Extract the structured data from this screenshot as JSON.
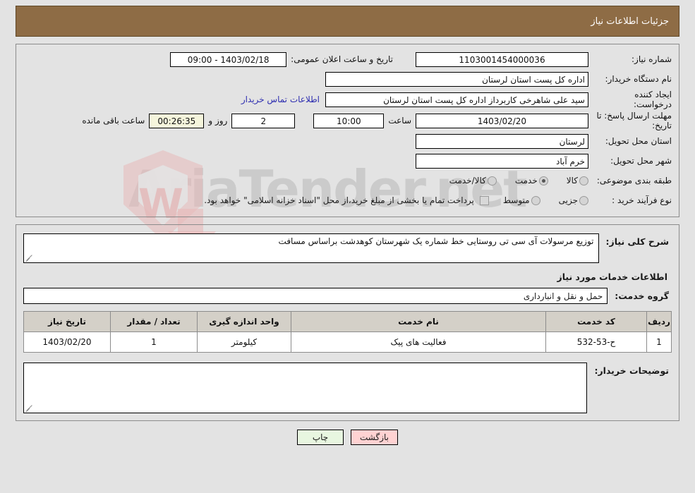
{
  "header": {
    "title": "جزئیات اطلاعات نیاز"
  },
  "form": {
    "need_number_label": "شماره نیاز:",
    "need_number_value": "1103001454000036",
    "announce_label": "تاریخ و ساعت اعلان عمومی:",
    "announce_value": "1403/02/18 - 09:00",
    "buyer_org_label": "نام دستگاه خریدار:",
    "buyer_org_value": "اداره کل پست استان لرستان",
    "creator_label": "ایجاد کننده درخواست:",
    "creator_value": "سید علی شاهرخی کاربرداز اداره کل پست استان لرستان",
    "contact_link": "اطلاعات تماس خریدار",
    "deadline_label": "مهلت ارسال پاسخ: تا تاریخ:",
    "deadline_date": "1403/02/20",
    "hour_label": "ساعت",
    "hour_value": "10:00",
    "days_value": "2",
    "days_label": "روز و",
    "countdown_value": "00:26:35",
    "remaining_label": "ساعت باقی مانده",
    "province_label": "استان محل تحویل:",
    "province_value": "لرستان",
    "city_label": "شهر محل تحویل:",
    "city_value": "خرم آباد",
    "category_label": "طبقه بندی موضوعی:",
    "category_options": [
      {
        "label": "کالا",
        "checked": false
      },
      {
        "label": "خدمت",
        "checked": true
      },
      {
        "label": "کالا/خدمت",
        "checked": false
      }
    ],
    "process_label": "نوع فرآیند خرید :",
    "process_options": [
      {
        "label": "جزیی",
        "checked": false
      },
      {
        "label": "متوسط",
        "checked": false
      }
    ],
    "treasury_checked": false,
    "treasury_note": "پرداخت تمام یا بخشی از مبلغ خرید،از محل \"اسناد خزانه اسلامی\" خواهد بود."
  },
  "need_description": {
    "label": "شرح کلی نیاز:",
    "value": "توزیع مرسولات آی سی تی روستایی خط شماره یک شهرستان کوهدشت براساس مسافت"
  },
  "services_section": {
    "heading": "اطلاعات خدمات مورد نیاز",
    "group_label": "گروه خدمت:",
    "group_value": "حمل و نقل و انبارداری",
    "columns": [
      "ردیف",
      "کد خدمت",
      "نام خدمت",
      "واحد اندازه گیری",
      "تعداد / مقدار",
      "تاریخ نیاز"
    ],
    "rows": [
      {
        "index": "1",
        "code": "ح-53-532",
        "name": "فعالیت های پیک",
        "unit": "کیلومتر",
        "quantity": "1",
        "date": "1403/02/20"
      }
    ]
  },
  "buyer_comments": {
    "label": "توضیحات خریدار:",
    "value": ""
  },
  "footer": {
    "back_label": "بازگشت",
    "print_label": "چاپ"
  },
  "colors": {
    "header_bg": "#8e6c45",
    "page_bg": "#e3e3e3",
    "link": "#2d2db0",
    "countdown_bg": "#f5f5dc",
    "back_btn_bg": "#ffd2d2",
    "print_btn_bg": "#e8f6e0",
    "table_header_bg": "#d4d0c8"
  }
}
